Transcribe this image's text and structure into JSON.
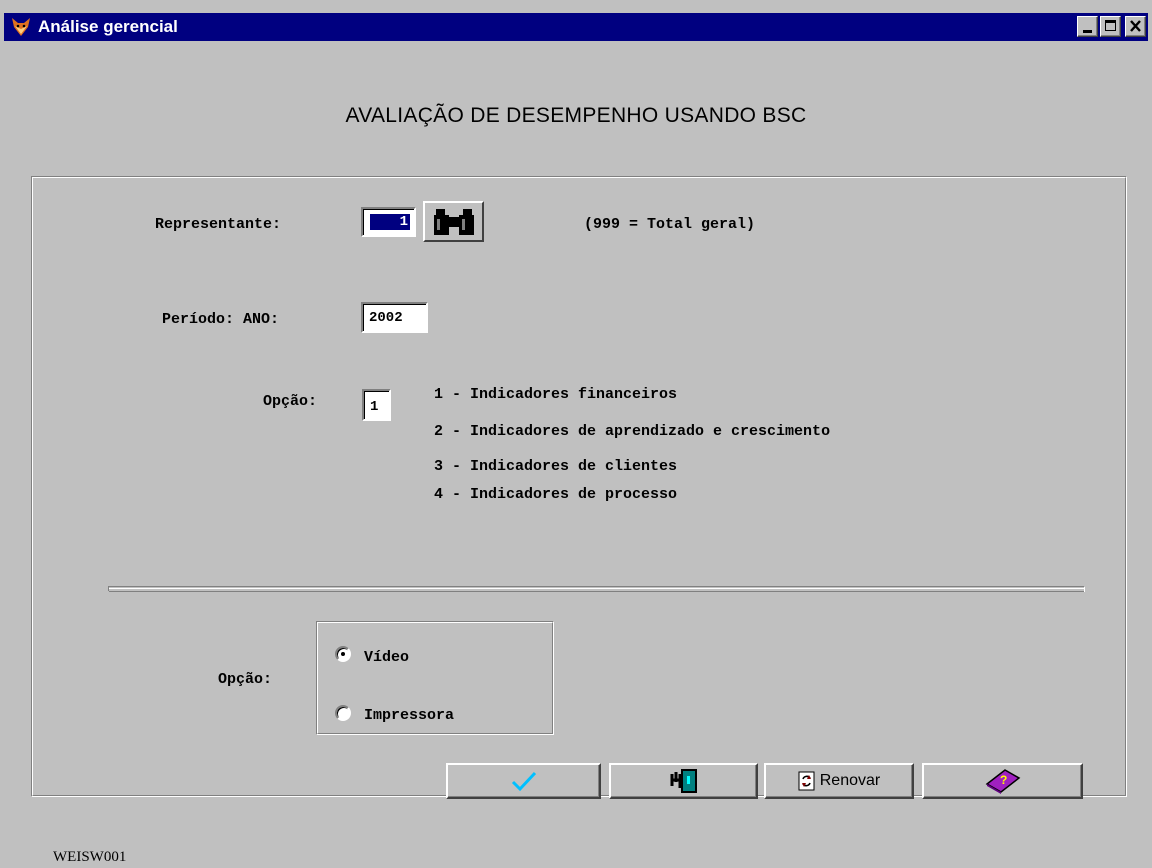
{
  "window": {
    "title": "Análise gerencial",
    "controls": [
      "minimize-icon",
      "maximize-icon",
      "close-icon"
    ]
  },
  "heading": "AVALIAÇÃO DE DESEMPENHO USANDO BSC",
  "form": {
    "representante": {
      "label": "Representante:",
      "value": "1",
      "hint": "(999 = Total geral)"
    },
    "periodo": {
      "label": "Período: ANO:",
      "value": "2002"
    },
    "opcao": {
      "label": "Opção:",
      "value": "1",
      "options": [
        "1 - Indicadores financeiros",
        "2 - Indicadores de aprendizado e crescimento",
        "3 - Indicadores de clientes",
        "4 - Indicadores de processo"
      ]
    },
    "saida": {
      "label": "Opção:",
      "options": [
        {
          "label": "Vídeo",
          "selected": true
        },
        {
          "label": "Impressora",
          "selected": false
        }
      ]
    }
  },
  "buttons": {
    "ok_icon": "checkmark-icon",
    "exit_icon": "exit-door-icon",
    "renovar_label": "Renovar",
    "help_icon": "help-book-icon"
  },
  "footer": "WEISW001",
  "colors": {
    "titlebar": "#000080",
    "face": "#c0c0c0",
    "accent_check": "#00c0ff"
  }
}
